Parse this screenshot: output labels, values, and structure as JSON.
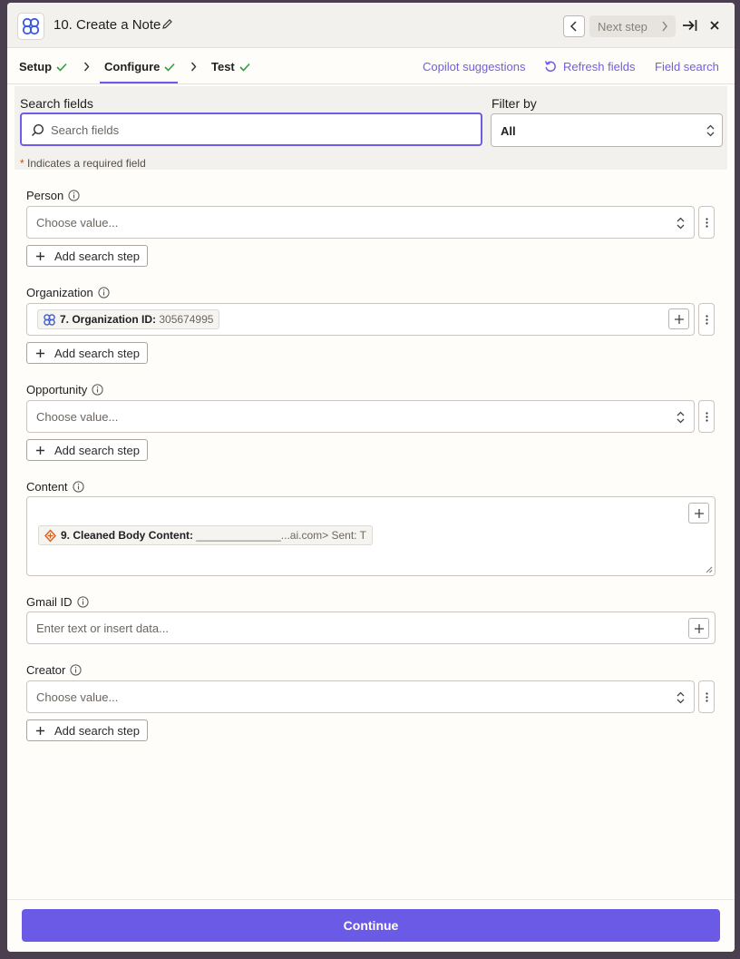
{
  "header": {
    "title": "10. Create a Note",
    "next_step_label": "Next step",
    "app_icon": "pipedrive-icon"
  },
  "tabs": {
    "items": [
      {
        "label": "Setup",
        "done": true
      },
      {
        "label": "Configure",
        "done": true,
        "active": true
      },
      {
        "label": "Test",
        "done": true
      }
    ],
    "copilot": "Copilot suggestions",
    "refresh": "Refresh fields",
    "field_search": "Field search"
  },
  "search": {
    "label": "Search fields",
    "placeholder": "Search fields",
    "filter_label": "Filter by",
    "filter_value": "All",
    "required_note": "Indicates a required field",
    "required_star": "*"
  },
  "fields": {
    "person": {
      "label": "Person",
      "placeholder": "Choose value..."
    },
    "organization": {
      "label": "Organization",
      "pill_label": "7. Organization ID:",
      "pill_value": "305674995"
    },
    "opportunity": {
      "label": "Opportunity",
      "placeholder": "Choose value..."
    },
    "content": {
      "label": "Content",
      "pill_label": "9. Cleaned Body Content:",
      "pill_value": "______________...ai.com> Sent: T"
    },
    "gmail_id": {
      "label": "Gmail ID",
      "placeholder": "Enter text or insert data..."
    },
    "creator": {
      "label": "Creator",
      "placeholder": "Choose value..."
    },
    "add_search_step": "Add search step"
  },
  "footer": {
    "continue_label": "Continue"
  },
  "colors": {
    "accent": "#6b5ae6",
    "success": "#2f9e44",
    "link": "#6f5fe0"
  }
}
